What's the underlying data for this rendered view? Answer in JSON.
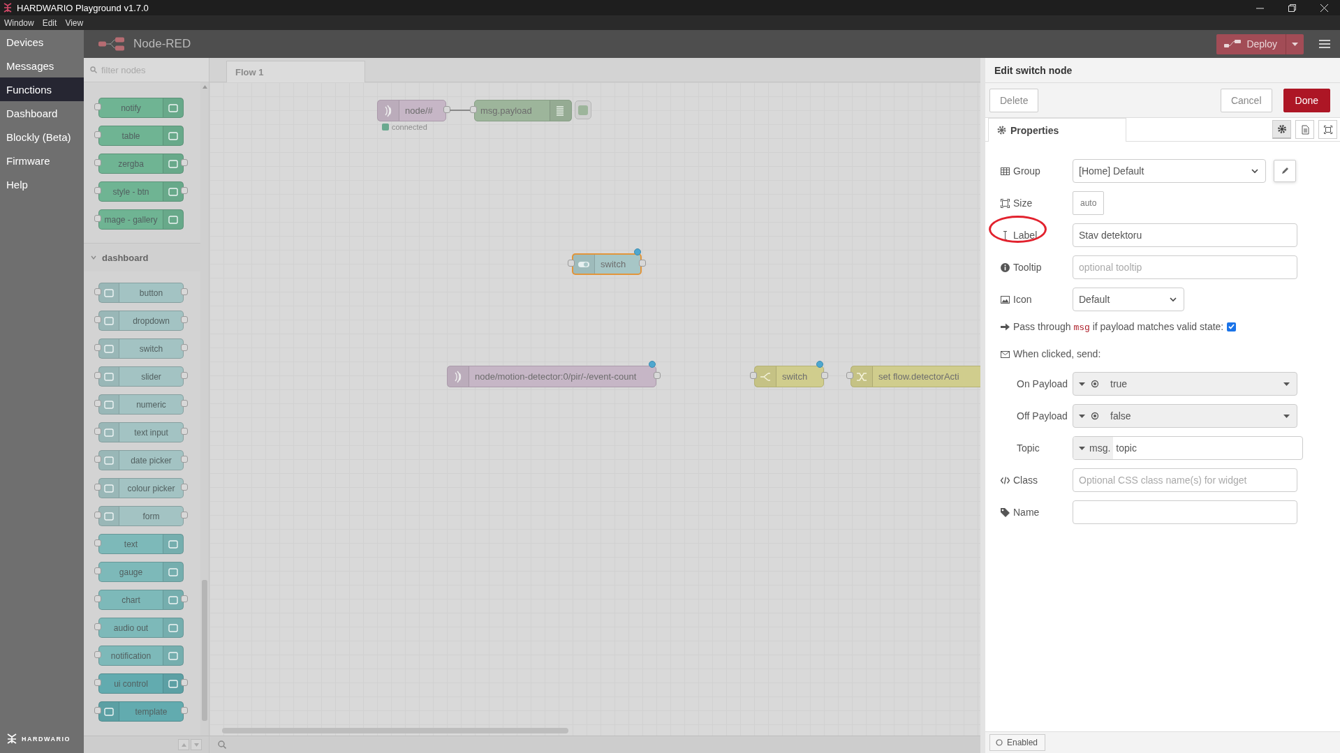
{
  "window": {
    "title": "HARDWARIO Playground v1.7.0"
  },
  "menu": [
    "Window",
    "Edit",
    "View"
  ],
  "sidebar": {
    "items": [
      {
        "label": "Devices",
        "selected": false
      },
      {
        "label": "Messages",
        "selected": false
      },
      {
        "label": "Functions",
        "selected": true
      },
      {
        "label": "Dashboard",
        "selected": false
      },
      {
        "label": "Blockly (Beta)",
        "selected": false
      },
      {
        "label": "Firmware",
        "selected": false
      },
      {
        "label": "Help",
        "selected": false
      }
    ],
    "logo": "HARDWARIO"
  },
  "header": {
    "title": "Node-RED",
    "deploy": "Deploy"
  },
  "palette": {
    "search": {
      "placeholder": "filter nodes"
    },
    "nodes": [
      {
        "label": "notify",
        "color": "#6fb493",
        "input": true,
        "output": false,
        "icon_left": false
      },
      {
        "label": "table",
        "color": "#6fb493",
        "input": true,
        "output": false,
        "icon_left": false
      },
      {
        "label": "zergba",
        "color": "#6fb493",
        "input": true,
        "output": true,
        "icon_left": false
      },
      {
        "label": "style - btn",
        "color": "#6fb493",
        "input": true,
        "output": true,
        "icon_left": false
      },
      {
        "label": "mage - gallery",
        "color": "#6fb493",
        "input": true,
        "output": false,
        "icon_left": false
      }
    ],
    "category": {
      "title": "dashboard",
      "expanded": true,
      "nodes": [
        {
          "label": "button",
          "color": "#a3c3c3",
          "input": true,
          "output": true,
          "icon_left": true
        },
        {
          "label": "dropdown",
          "color": "#a3c3c3",
          "input": true,
          "output": true,
          "icon_left": true
        },
        {
          "label": "switch",
          "color": "#a3c3c3",
          "input": true,
          "output": true,
          "icon_left": true
        },
        {
          "label": "slider",
          "color": "#a3c3c3",
          "input": true,
          "output": true,
          "icon_left": true
        },
        {
          "label": "numeric",
          "color": "#a3c3c3",
          "input": true,
          "output": true,
          "icon_left": true
        },
        {
          "label": "text input",
          "color": "#a3c3c3",
          "input": true,
          "output": true,
          "icon_left": true
        },
        {
          "label": "date picker",
          "color": "#a3c3c3",
          "input": true,
          "output": true,
          "icon_left": true
        },
        {
          "label": "colour picker",
          "color": "#a3c3c3",
          "input": true,
          "output": true,
          "icon_left": true
        },
        {
          "label": "form",
          "color": "#a3c3c3",
          "input": true,
          "output": true,
          "icon_left": true
        },
        {
          "label": "text",
          "color": "#7db9b9",
          "input": true,
          "output": false,
          "icon_left": false
        },
        {
          "label": "gauge",
          "color": "#7db9b9",
          "input": true,
          "output": false,
          "icon_left": false
        },
        {
          "label": "chart",
          "color": "#7db9b9",
          "input": true,
          "output": true,
          "icon_left": false
        },
        {
          "label": "audio out",
          "color": "#7db9b9",
          "input": true,
          "output": false,
          "icon_left": false
        },
        {
          "label": "notification",
          "color": "#7db9b9",
          "input": true,
          "output": false,
          "icon_left": false
        },
        {
          "label": "ui control",
          "color": "#62abaf",
          "input": true,
          "output": true,
          "icon_left": false
        },
        {
          "label": "template",
          "color": "#62abaf",
          "input": true,
          "output": true,
          "icon_left": true
        }
      ]
    }
  },
  "flow": {
    "tabs": [
      {
        "label": "Flow 1",
        "selected": true
      }
    ],
    "nodes": [
      {
        "kind": "mqtt-in",
        "label": "node/#",
        "selected": false,
        "changed": false,
        "wired": true,
        "status": "connected"
      },
      {
        "kind": "debug",
        "label": "msg.payload",
        "selected": false,
        "changed": false,
        "wired": false
      },
      {
        "kind": "ui-switch",
        "label": "switch",
        "selected": true,
        "changed": true,
        "wired": false
      },
      {
        "kind": "mqtt-in",
        "label": "node/motion-detector:0/pir/-/event-count",
        "selected": false,
        "changed": true,
        "wired": false
      },
      {
        "kind": "switch",
        "label": "switch",
        "selected": false,
        "changed": true,
        "wired": false
      },
      {
        "kind": "change",
        "label": "set flow.detectorActi",
        "selected": false,
        "changed": false,
        "wired": false
      }
    ]
  },
  "editor": {
    "title": "Edit switch node",
    "buttons": [
      {
        "label": "Delete",
        "kind": "plain"
      },
      {
        "label": "Cancel",
        "kind": "plain"
      },
      {
        "label": "Done",
        "kind": "primary"
      }
    ],
    "tabs": [
      {
        "label": "Properties",
        "selected": true
      }
    ],
    "icon_tabs": [
      {
        "selected": true
      },
      {
        "selected": false
      },
      {
        "selected": false
      }
    ],
    "fields": [
      {
        "kind": "select",
        "label": "Group",
        "value": "[Home] Default",
        "edit_button": true
      },
      {
        "kind": "size",
        "label": "Size",
        "value": "auto"
      },
      {
        "kind": "text",
        "label": "Label",
        "value": "Stav detektoru",
        "annotated": true
      },
      {
        "kind": "text",
        "label": "Tooltip",
        "placeholder": "optional tooltip",
        "annotated": false
      },
      {
        "kind": "select",
        "label": "Icon",
        "value": "Default",
        "edit_button": false
      },
      {
        "kind": "checkbox",
        "text_before": "Pass through",
        "code": "msg",
        "text_after": "if payload matches valid state:",
        "checked": true
      },
      {
        "kind": "heading",
        "text": "When clicked, send:"
      },
      {
        "kind": "typed",
        "label": "On Payload",
        "value": "true"
      },
      {
        "kind": "typed",
        "label": "Off Payload",
        "value": "false"
      },
      {
        "kind": "msg",
        "label": "Topic",
        "prefix": "msg.",
        "value": "topic"
      },
      {
        "kind": "text",
        "label": "Class",
        "placeholder": "Optional CSS class name(s) for widget",
        "annotated": false
      },
      {
        "kind": "text",
        "label": "Name",
        "annotated": false
      }
    ],
    "footer": {
      "label": "Enabled"
    }
  }
}
